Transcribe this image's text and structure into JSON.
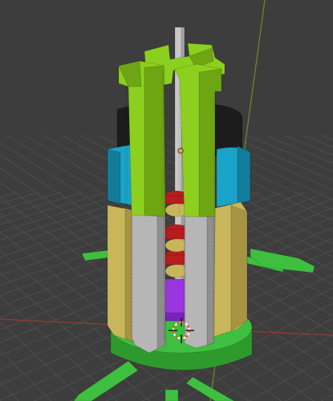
{
  "viewport": {
    "kind": "3d-viewport",
    "background_color": "#3d3d3d",
    "grid_color": "#4d4d4d",
    "x_axis_color": "#8a3a3a",
    "y_axis_color": "#6f8a2a"
  },
  "model": {
    "colors": {
      "green_base": "#3fbf3f",
      "green_dark": "#2e9a2e",
      "lime": "#8ccf1e",
      "lime_dark": "#6ea512",
      "cyan": "#1aa3c8",
      "cyan_dark": "#127c99",
      "khaki": "#c9b65a",
      "khaki_dark": "#a69443",
      "grey": "#b6b6b6",
      "grey_dark": "#8f8f8f",
      "black": "#1c1c1c",
      "red": "#b81d1d",
      "purple": "#9b35e0",
      "shaft": "#c8c8c8"
    }
  },
  "cursor": {
    "icon": "3d-cursor-icon",
    "ring_color_a": "#e05a3a",
    "ring_color_b": "#ffffff"
  }
}
